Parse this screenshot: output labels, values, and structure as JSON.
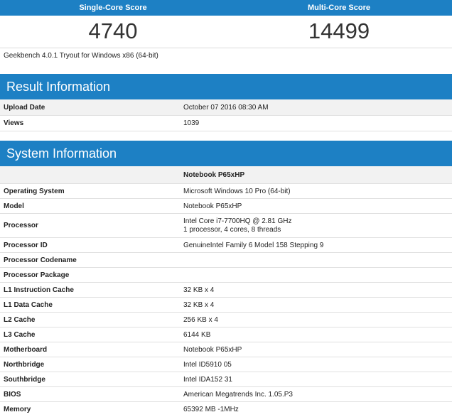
{
  "scores": {
    "single_label": "Single-Core Score",
    "multi_label": "Multi-Core Score",
    "single_value": "4740",
    "multi_value": "14499"
  },
  "version": "Geekbench 4.0.1 Tryout for Windows x86 (64-bit)",
  "result_info": {
    "title": "Result Information",
    "rows": [
      {
        "key": "Upload Date",
        "value": "October 07 2016 08:30 AM"
      },
      {
        "key": "Views",
        "value": "1039"
      }
    ]
  },
  "system_info": {
    "title": "System Information",
    "header_value": "Notebook P65xHP",
    "rows": [
      {
        "key": "Operating System",
        "value": "Microsoft Windows 10 Pro (64-bit)"
      },
      {
        "key": "Model",
        "value": "Notebook P65xHP"
      },
      {
        "key": "Processor",
        "value": "Intel Core i7-7700HQ @ 2.81 GHz",
        "value2": "1 processor, 4 cores, 8 threads"
      },
      {
        "key": "Processor ID",
        "value": "GenuineIntel Family 6 Model 158 Stepping 9"
      },
      {
        "key": "Processor Codename",
        "value": ""
      },
      {
        "key": "Processor Package",
        "value": ""
      },
      {
        "key": "L1 Instruction Cache",
        "value": "32 KB x 4"
      },
      {
        "key": "L1 Data Cache",
        "value": "32 KB x 4"
      },
      {
        "key": "L2 Cache",
        "value": "256 KB x 4"
      },
      {
        "key": "L3 Cache",
        "value": "6144 KB"
      },
      {
        "key": "Motherboard",
        "value": "Notebook P65xHP"
      },
      {
        "key": "Northbridge",
        "value": "Intel ID5910 05"
      },
      {
        "key": "Southbridge",
        "value": "Intel IDA152 31"
      },
      {
        "key": "BIOS",
        "value": "American Megatrends Inc. 1.05.P3"
      },
      {
        "key": "Memory",
        "value": "65392 MB -1MHz"
      }
    ]
  },
  "colors": {
    "header_blue": "#1d80c4",
    "row_shade": "#f2f2f2"
  }
}
